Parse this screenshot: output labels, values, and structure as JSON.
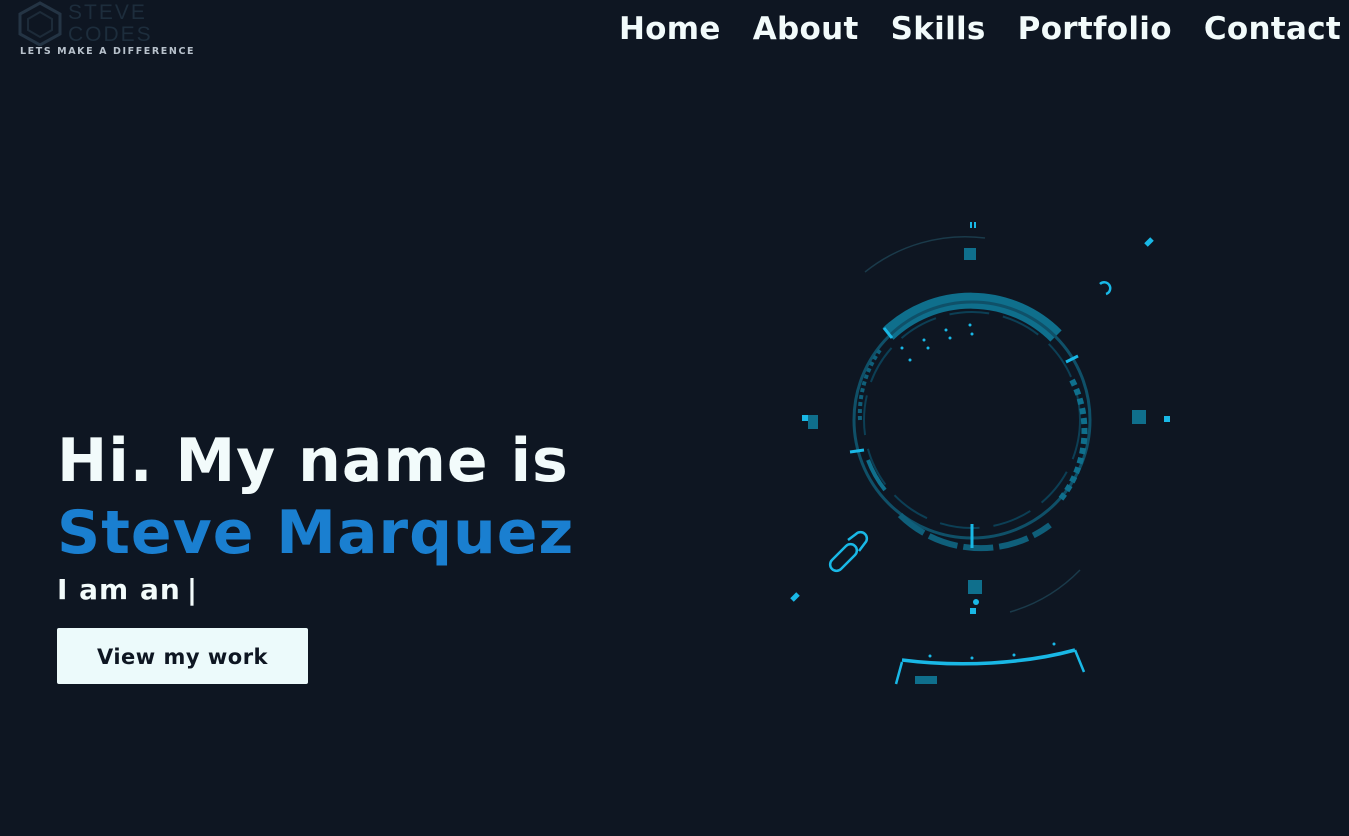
{
  "logo": {
    "line1": "STEVE",
    "line2": "CODES",
    "tagline": "LETS MAKE A DIFFERENCE"
  },
  "nav": {
    "items": [
      "Home",
      "About",
      "Skills",
      "Portfolio",
      "Contact"
    ]
  },
  "hero": {
    "greeting": "Hi. My name is",
    "name": "Steve Marquez",
    "typed_prefix": "I am an",
    "cursor": "|",
    "cta_label": "View my work"
  },
  "colors": {
    "background": "#0e1622",
    "accent_blue": "#1a7fd0",
    "hud_cyan": "#19b8e6",
    "text": "#f2fbfb"
  },
  "icons": [
    "logo-hexagon-icon",
    "hud-graphic-icon"
  ]
}
